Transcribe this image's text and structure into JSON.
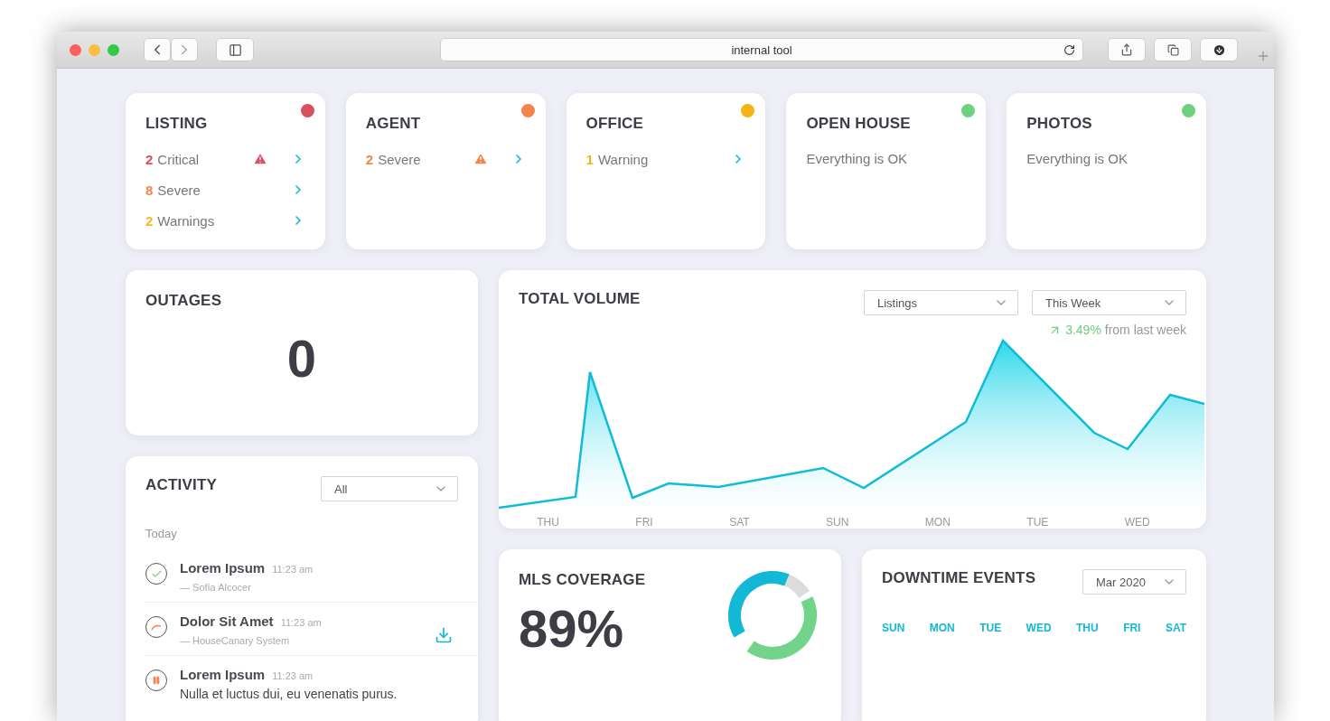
{
  "browser": {
    "address": "internal tool"
  },
  "status_cards": [
    {
      "title": "LISTING",
      "color": "#d9505f",
      "issues": [
        {
          "count": "2",
          "label": "Critical",
          "color": "#d9505f",
          "alert": true
        },
        {
          "count": "8",
          "label": "Severe",
          "color": "#f5844c",
          "alert": false
        },
        {
          "count": "2",
          "label": "Warnings",
          "color": "#f7b924",
          "alert": false
        }
      ]
    },
    {
      "title": "AGENT",
      "color": "#f5844c",
      "issues": [
        {
          "count": "2",
          "label": "Severe",
          "color": "#f5844c",
          "alert": true
        }
      ]
    },
    {
      "title": "OFFICE",
      "color": "#f7b215",
      "issues": [
        {
          "count": "1",
          "label": "Warning",
          "color": "#f7b215",
          "alert": false
        }
      ]
    },
    {
      "title": "OPEN HOUSE",
      "color": "#6fd07f",
      "message": "Everything is OK"
    },
    {
      "title": "PHOTOS",
      "color": "#6fd07f",
      "message": "Everything is OK"
    }
  ],
  "outages": {
    "title": "OUTAGES",
    "value": "0"
  },
  "activity": {
    "title": "ACTIVITY",
    "filter": "All",
    "group": "Today",
    "items": [
      {
        "kind": "done",
        "title": "Lorem Ipsum",
        "time": "11:23 am",
        "byline": "— Sofía Alcocer",
        "download": false
      },
      {
        "kind": "progress",
        "title": "Dolor Sit Amet",
        "time": "11:23 am",
        "byline": "— HouseCanary System",
        "download": true
      },
      {
        "kind": "paused",
        "title": "Lorem Ipsum",
        "time": "11:23 am",
        "text": "Nulla et luctus dui, eu venenatis purus.",
        "download": false
      }
    ]
  },
  "total_volume": {
    "title": "TOTAL VOLUME",
    "metric": "Listings",
    "period": "This Week",
    "change": "3.49%",
    "change_text": "from last week",
    "x_labels": [
      "THU",
      "FRI",
      "SAT",
      "SUN",
      "MON",
      "TUE",
      "WED"
    ]
  },
  "mls_coverage": {
    "title": "MLS COVERAGE",
    "value": "89%"
  },
  "downtime": {
    "title": "DOWNTIME EVENTS",
    "month": "Mar 2020",
    "weekdays": [
      "SUN",
      "MON",
      "TUE",
      "WED",
      "THU",
      "FRI",
      "SAT"
    ]
  }
}
